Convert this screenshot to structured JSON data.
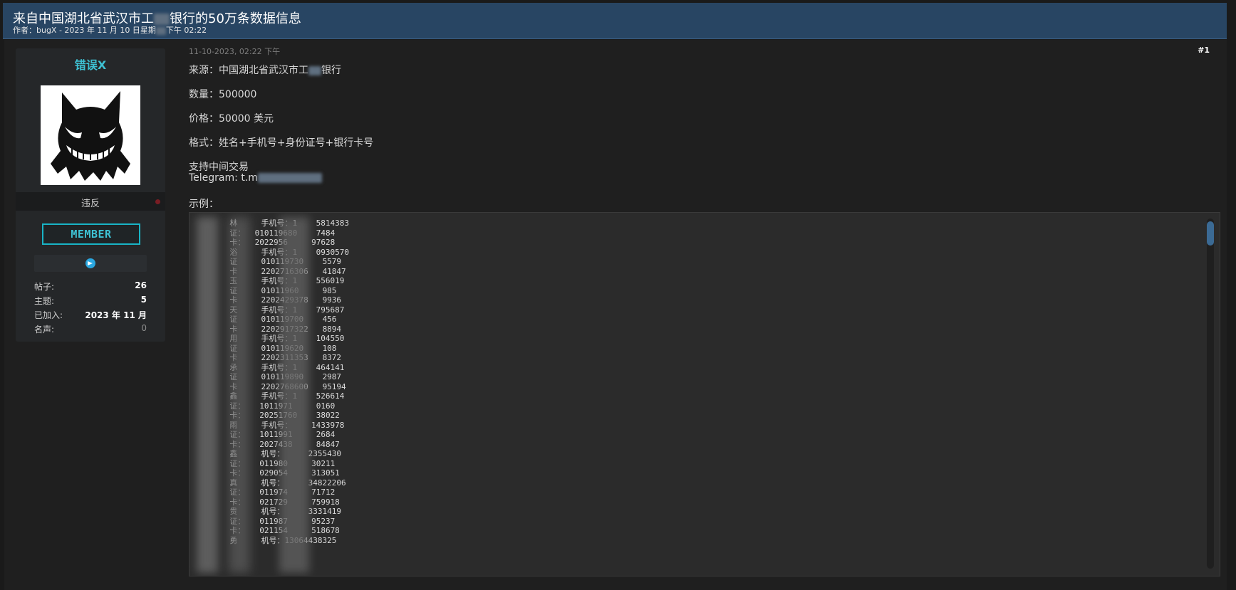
{
  "thread": {
    "title_prefix": "来自中国湖北省武汉市工",
    "title_suffix": "银行的50万条数据信息",
    "meta_prefix": "作者：bugX - 2023 年 11 月 10 日星期",
    "meta_suffix": "下午 02:22"
  },
  "user": {
    "name": "错误X",
    "title": "违反",
    "badge": "MEMBER",
    "stats": [
      {
        "label": "帖子:",
        "value": "26"
      },
      {
        "label": "主题:",
        "value": "5"
      },
      {
        "label": "已加入:",
        "value": "2023 年 11 月"
      },
      {
        "label": "名声:",
        "value": "0"
      }
    ]
  },
  "post": {
    "date": "11-10-2023, 02:22 下午",
    "number": "#1",
    "source_prefix": "来源：中国湖北省武汉市工",
    "source_suffix": "银行",
    "quantity": "数量：500000",
    "price": "价格：50000 美元",
    "format": "格式：姓名+手机号+身份证号+银行卡号",
    "escrow": "支持中间交易",
    "telegram": "Telegram: t.m",
    "example_label": "示例：",
    "code_lines": [
      "       林     手机号：1    5814383",
      "       证：  010119680    7484",
      "       卡：  2022956     97628",
      "       浴     手机号：1    0930570",
      "       证     010119730    5579",
      "       卡     2202716306   41847",
      "       玉     手机号：1    556019",
      "       证     01011960     985",
      "       卡     2202429378   9936",
      "       天     手机号：1    795687",
      "       证     010119700    456",
      "       卡     2202917322   8894",
      "       用     手机号：1    104550",
      "       证     010119620    108",
      "       卡     2202311353   8372",
      "       承     手机号：1    464141",
      "       证     010119890    2987",
      "       卡     2202768600   95194",
      "       鑫     手机号：1    526614",
      "       证：   1011971     0160",
      "       卡：   20251760    38022",
      "       雨     手机号：    1433978",
      "       证：   1011991     2684",
      "       卡：   2027438     84847",
      "       鑫     机号：     2355430",
      "       证：   011980     30211",
      "       卡：   029054     313051",
      "       真     机号：     34822206",
      "       证：   011974     71712",
      "       卡：   021729     759918",
      "       贵     机号：     3331419",
      "       证：   011987     95237",
      "       卡：   021154     518678",
      "       勇     机号：13064438325"
    ]
  },
  "colors": {
    "header_bg": "#284563",
    "accent": "#3ec1d3",
    "scroll_thumb": "#3b6a94"
  }
}
